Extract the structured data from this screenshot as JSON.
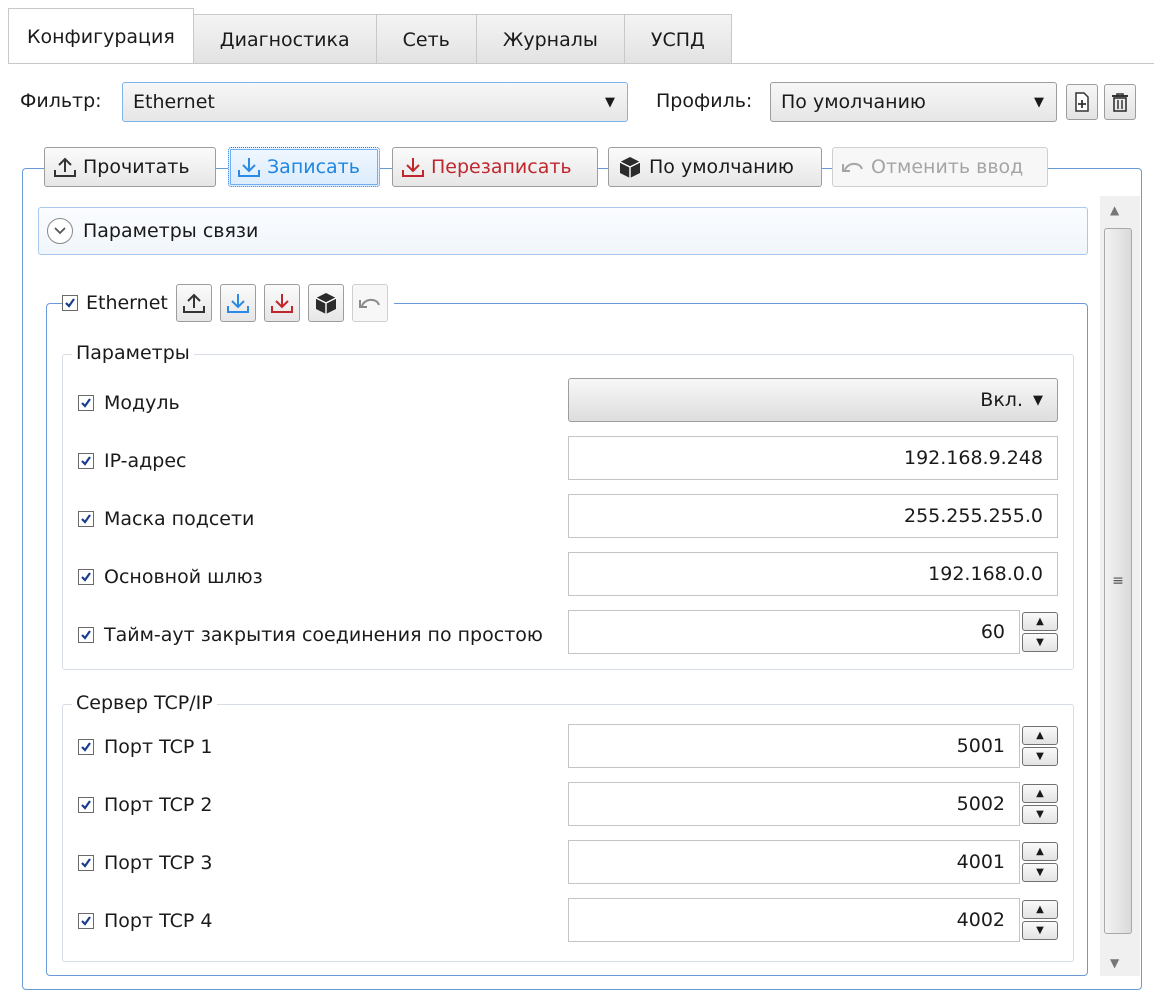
{
  "tabs": [
    "Конфигурация",
    "Диагностика",
    "Сеть",
    "Журналы",
    "УСПД"
  ],
  "filter": {
    "label": "Фильтр:",
    "value": "Ethernet"
  },
  "profile": {
    "label": "Профиль:",
    "value": "По умолчанию"
  },
  "toolbar": {
    "read": "Прочитать",
    "write": "Записать",
    "rewrite": "Перезаписать",
    "defaults": "По умолчанию",
    "undo": "Отменить ввод"
  },
  "expander": {
    "title": "Параметры связи"
  },
  "ethernet": {
    "title": "Ethernet",
    "params_legend": "Параметры",
    "rows": [
      {
        "label": "Модуль",
        "value": "Вкл."
      },
      {
        "label": "IP-адрес",
        "value": "192.168.9.248"
      },
      {
        "label": "Маска подсети",
        "value": "255.255.255.0"
      },
      {
        "label": "Основной шлюз",
        "value": "192.168.0.0"
      },
      {
        "label": "Тайм-аут закрытия соединения по простою",
        "value": "60"
      }
    ],
    "server_legend": "Сервер TCP/IP",
    "ports": [
      {
        "label": "Порт TCP 1",
        "value": "5001"
      },
      {
        "label": "Порт TCP 2",
        "value": "5002"
      },
      {
        "label": "Порт TCP 3",
        "value": "4001"
      },
      {
        "label": "Порт TCP 4",
        "value": "4002"
      }
    ]
  },
  "icons": {
    "read": "upload-icon",
    "write": "download-icon",
    "rewrite": "rewrite-icon",
    "defaults": "package-icon",
    "undo": "undo-icon",
    "add_profile": "add-profile-icon",
    "delete_profile": "trash-icon"
  },
  "colors": {
    "accent": "#1f86e0",
    "danger": "#c0272d",
    "frame": "#6a9bd8"
  }
}
